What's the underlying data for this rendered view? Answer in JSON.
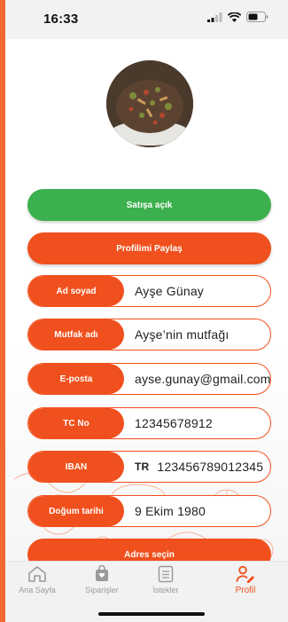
{
  "status_bar": {
    "time": "16:33"
  },
  "profile": {
    "avatar_icon": "food-photo",
    "sale_button": "Satışa açık",
    "share_button": "Profilimi Paylaş",
    "fields": [
      {
        "label": "Ad soyad",
        "value": "Ayşe Günay"
      },
      {
        "label": "Mutfak adı",
        "value": "Ayşe’nin mutfağı"
      },
      {
        "label": "E-posta",
        "value": "ayse.gunay@gmail.com"
      },
      {
        "label": "TC No",
        "value": "12345678912"
      },
      {
        "label": "IBAN",
        "prefix": "TR",
        "value": "123456789012345"
      },
      {
        "label": "Doğum tarihi",
        "value": "9 Ekim 1980"
      }
    ],
    "address_button": "Adres seçin"
  },
  "tabs": [
    {
      "label": "Ana Sayfa",
      "icon": "home-icon",
      "active": false
    },
    {
      "label": "Siparişler",
      "icon": "shopping-bag-icon",
      "active": false
    },
    {
      "label": "İstekler",
      "icon": "list-icon",
      "active": false
    },
    {
      "label": "Profil",
      "icon": "profile-edit-icon",
      "active": true
    }
  ],
  "colors": {
    "accent": "#f0501d",
    "green": "#3cb04e"
  }
}
